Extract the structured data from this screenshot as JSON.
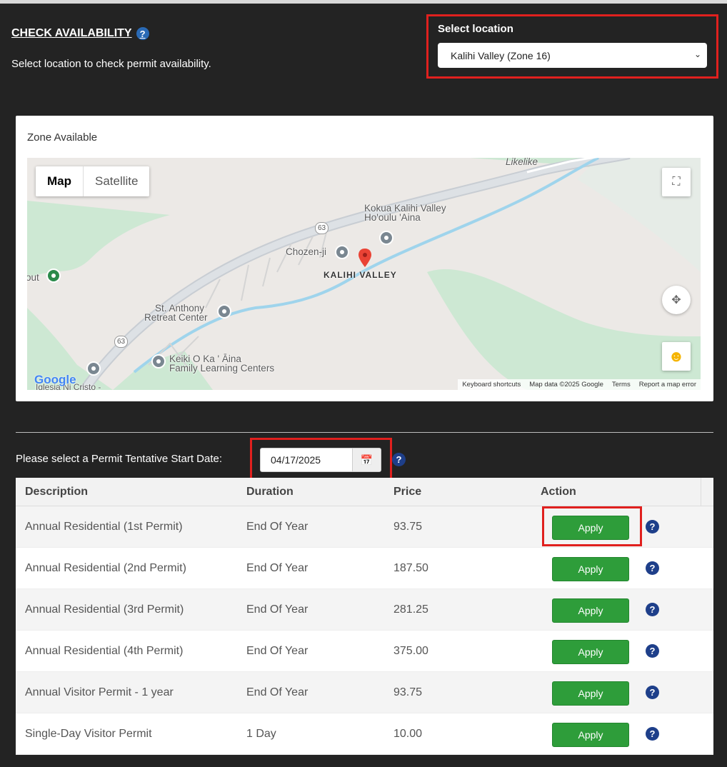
{
  "header": {
    "title": "CHECK AVAILABILITY",
    "help": "?",
    "subtitle": "Select location to check permit availability."
  },
  "location": {
    "label": "Select location",
    "selected": "Kalihi Valley (Zone 16)"
  },
  "map": {
    "zone_label": "Zone Available",
    "type_map": "Map",
    "type_satellite": "Satellite",
    "labels": {
      "likelike": "Likelike",
      "kokua": "Kokua Kalihi Valley",
      "hooulu": "Ho'oulu 'Aina",
      "chozenji": "Chozen-ji",
      "kalihi": "KALIHI VALLEY",
      "out": "out",
      "stanthony1": "St. Anthony",
      "stanthony2": "Retreat Center",
      "keiki1": "Keiki O Ka ' Āina",
      "keiki2": "Family Learning Centers",
      "iglesia": "Iglesia Ni Cristo -",
      "route1": "63",
      "route2": "63"
    },
    "google": "Google",
    "attribution": {
      "keyboard": "Keyboard shortcuts",
      "data": "Map data ©2025 Google",
      "terms": "Terms",
      "report": "Report a map error"
    }
  },
  "date": {
    "label": "Please select a Permit Tentative Start Date:",
    "value": "04/17/2025"
  },
  "table": {
    "headers": [
      "Description",
      "Duration",
      "Price",
      "Action"
    ],
    "rows": [
      {
        "description": "Annual Residential (1st Permit)",
        "duration": "End Of Year",
        "price": "93.75",
        "action": "Apply"
      },
      {
        "description": "Annual Residential (2nd Permit)",
        "duration": "End Of Year",
        "price": "187.50",
        "action": "Apply"
      },
      {
        "description": "Annual Residential (3rd Permit)",
        "duration": "End Of Year",
        "price": "281.25",
        "action": "Apply"
      },
      {
        "description": "Annual Residential (4th Permit)",
        "duration": "End Of Year",
        "price": "375.00",
        "action": "Apply"
      },
      {
        "description": "Annual Visitor Permit - 1 year",
        "duration": "End Of Year",
        "price": "93.75",
        "action": "Apply"
      },
      {
        "description": "Single-Day Visitor Permit",
        "duration": "1 Day",
        "price": "10.00",
        "action": "Apply"
      }
    ]
  },
  "colors": {
    "background": "#232323",
    "highlight": "#e0201e",
    "apply": "#2e9d3a",
    "help": "#1e3f8a"
  }
}
